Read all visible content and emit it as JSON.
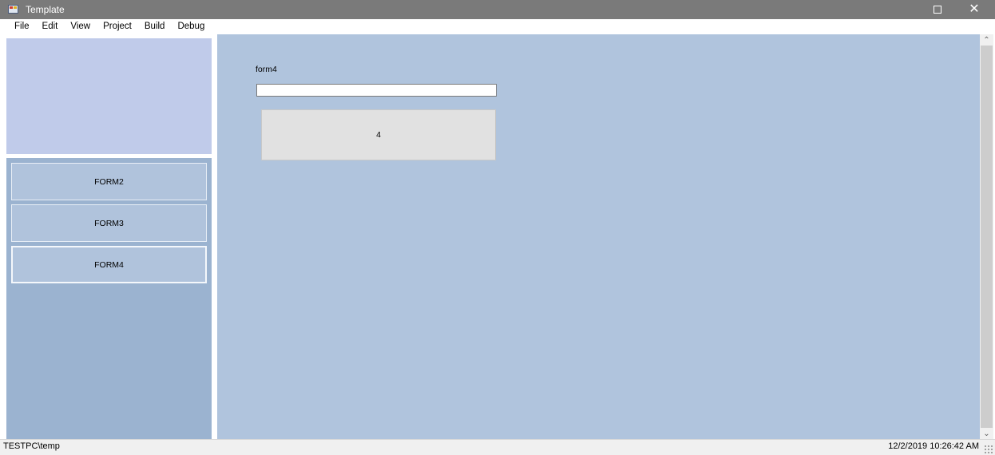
{
  "window": {
    "title": "Template",
    "maximize_icon": "maximize-icon",
    "close_glyph": "✕"
  },
  "menu": {
    "items": [
      "File",
      "Edit",
      "View",
      "Project",
      "Build",
      "Debug"
    ]
  },
  "sidebar": {
    "buttons": [
      {
        "label": "FORM2",
        "active": false
      },
      {
        "label": "FORM3",
        "active": false
      },
      {
        "label": "FORM4",
        "active": true
      }
    ]
  },
  "main": {
    "form_label": "form4",
    "input_value": "",
    "button_label": "4"
  },
  "statusbar": {
    "left": "TESTPC\\temp",
    "right": "12/2/2019 10:26:42 AM"
  },
  "scrollbar": {
    "up_glyph": "⌃",
    "down_glyph": "⌄"
  },
  "colors": {
    "titlebar": "#7a7a7a",
    "content_bg": "#b0c4dd",
    "logo_bg": "#c0cbea",
    "nav_bg": "#9bb3d0"
  }
}
